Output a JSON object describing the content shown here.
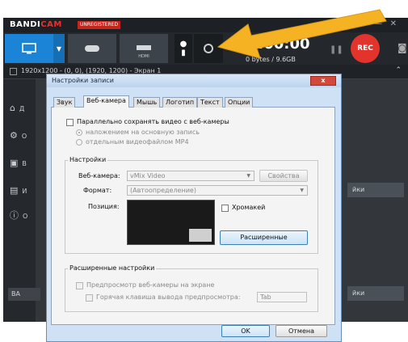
{
  "bandicam": {
    "logo_prefix": "BANDI",
    "logo_suffix": "CAM",
    "unregistered": "UNREGISTERED",
    "hdmi_label": "HDMI",
    "timer": "00:00:00",
    "size": "0 bytes / 9.6GB",
    "rec": "REC",
    "status": "1920x1200 - (0, 0), (1920, 1200) - Экран 1",
    "side_items": [
      "Д",
      "О",
      "В",
      "И",
      "О"
    ],
    "main_buttons": [
      "йки",
      "йки"
    ],
    "bottom_button": "BA"
  },
  "dialog": {
    "title": "Настройки записи",
    "close": "x",
    "tabs": [
      "Звук",
      "Веб-камера",
      "Мышь",
      "Логотип",
      "Текст",
      "Опции"
    ],
    "save_webcam": "Параллельно сохранять видео с веб-камеры",
    "overlay_option": "наложением на основную запись",
    "separate_option": "отдельным видеофайлом MP4",
    "settings_group": "Настройки",
    "webcam_label": "Веб-камера:",
    "webcam_value": "vMix Video",
    "properties": "Свойства",
    "format_label": "Формат:",
    "format_value": "(Автоопределение)",
    "position_label": "Позиция:",
    "chromakey": "Хромакей",
    "advanced_button": "Расширенные",
    "advanced_group": "Расширенные настройки",
    "preview_screen": "Предпросмотр веб-камеры на экране",
    "hotkey_label": "Горячая клавиша вывода предпросмотра:",
    "hotkey_value": "Tab",
    "ok": "OK",
    "cancel": "Отмена"
  },
  "colors": {
    "arrow": "#f5b324",
    "rec": "#e2342d",
    "screen_mode": "#1c84d6"
  }
}
